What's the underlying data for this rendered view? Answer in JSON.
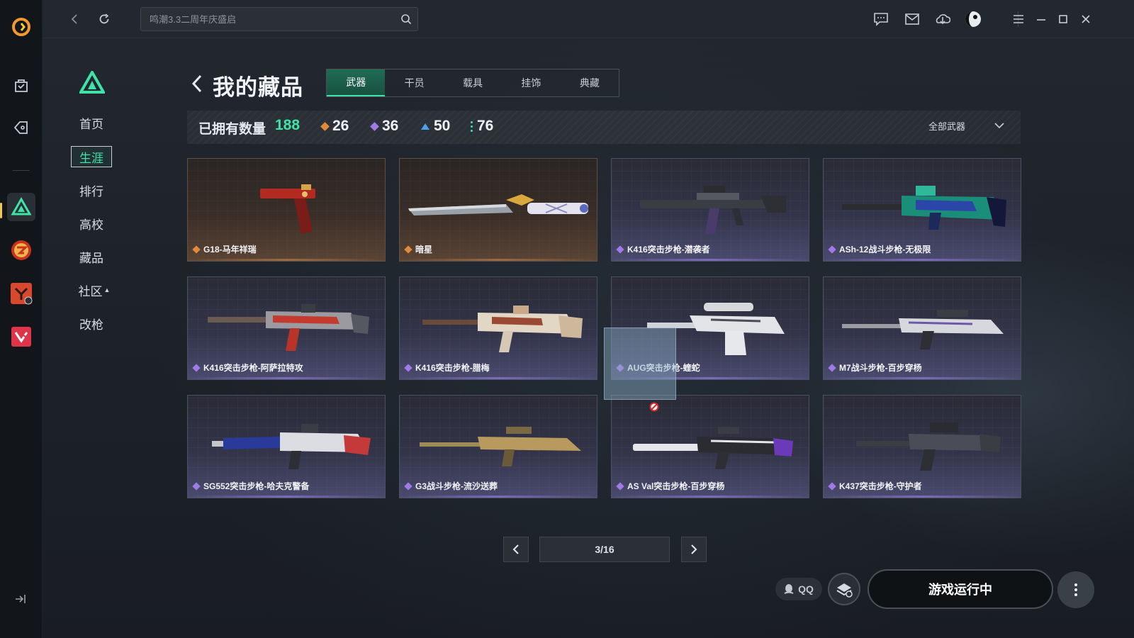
{
  "search": {
    "placeholder": "鸣潮3.3二周年庆盛启"
  },
  "secondary_nav": {
    "items": [
      {
        "label": "首页"
      },
      {
        "label": "生涯"
      },
      {
        "label": "排行"
      },
      {
        "label": "高校"
      },
      {
        "label": "藏品"
      },
      {
        "label": "社区"
      },
      {
        "label": "改枪"
      }
    ],
    "active_index": 1
  },
  "page": {
    "title": "我的藏品",
    "tabs": [
      {
        "label": "武器"
      },
      {
        "label": "干员"
      },
      {
        "label": "载具"
      },
      {
        "label": "挂饰"
      },
      {
        "label": "典藏"
      }
    ],
    "active_tab": 0
  },
  "stats": {
    "owned_label": "已拥有数量",
    "owned_total": "188",
    "rarity": [
      {
        "color": "#e08a3c",
        "count": "26"
      },
      {
        "color": "#a07ae6",
        "count": "36"
      },
      {
        "color": "#4aa3e8",
        "count": "50"
      },
      {
        "color": "#3fe3a6",
        "count": "76"
      }
    ],
    "filter_label": "全部武器"
  },
  "cards": [
    {
      "name": "G18-马年祥瑞",
      "rarity": "gold",
      "icon": "pistol-icon"
    },
    {
      "name": "暗星",
      "rarity": "gold",
      "icon": "knife-icon"
    },
    {
      "name": "K416突击步枪-潜袭者",
      "rarity": "purple",
      "icon": "rifle-icon"
    },
    {
      "name": "ASh-12战斗步枪-无极限",
      "rarity": "purple",
      "icon": "rifle-icon"
    },
    {
      "name": "K416突击步枪-阿萨拉特攻",
      "rarity": "purple",
      "icon": "rifle-icon"
    },
    {
      "name": "K416突击步枪-腊梅",
      "rarity": "purple",
      "icon": "rifle-icon"
    },
    {
      "name": "AUG突击步枪-蝰蛇",
      "rarity": "purple",
      "icon": "rifle-icon"
    },
    {
      "name": "M7战斗步枪-百步穿杨",
      "rarity": "purple",
      "icon": "rifle-icon"
    },
    {
      "name": "SG552突击步枪-哈夫克警备",
      "rarity": "purple",
      "icon": "rifle-icon"
    },
    {
      "name": "G3战斗步枪-流沙送葬",
      "rarity": "purple",
      "icon": "rifle-icon"
    },
    {
      "name": "AS Val突击步枪-百步穿杨",
      "rarity": "purple",
      "icon": "rifle-icon"
    },
    {
      "name": "K437突击步枪-守护者",
      "rarity": "purple",
      "icon": "rifle-icon"
    }
  ],
  "pagination": {
    "current": "3/16"
  },
  "bottom": {
    "qq_label": "QQ",
    "launch_label": "游戏运行中"
  },
  "colors": {
    "accent": "#3fe3a6",
    "gold_rarity": "#e08a3c",
    "purple_rarity": "#a07ae6"
  }
}
